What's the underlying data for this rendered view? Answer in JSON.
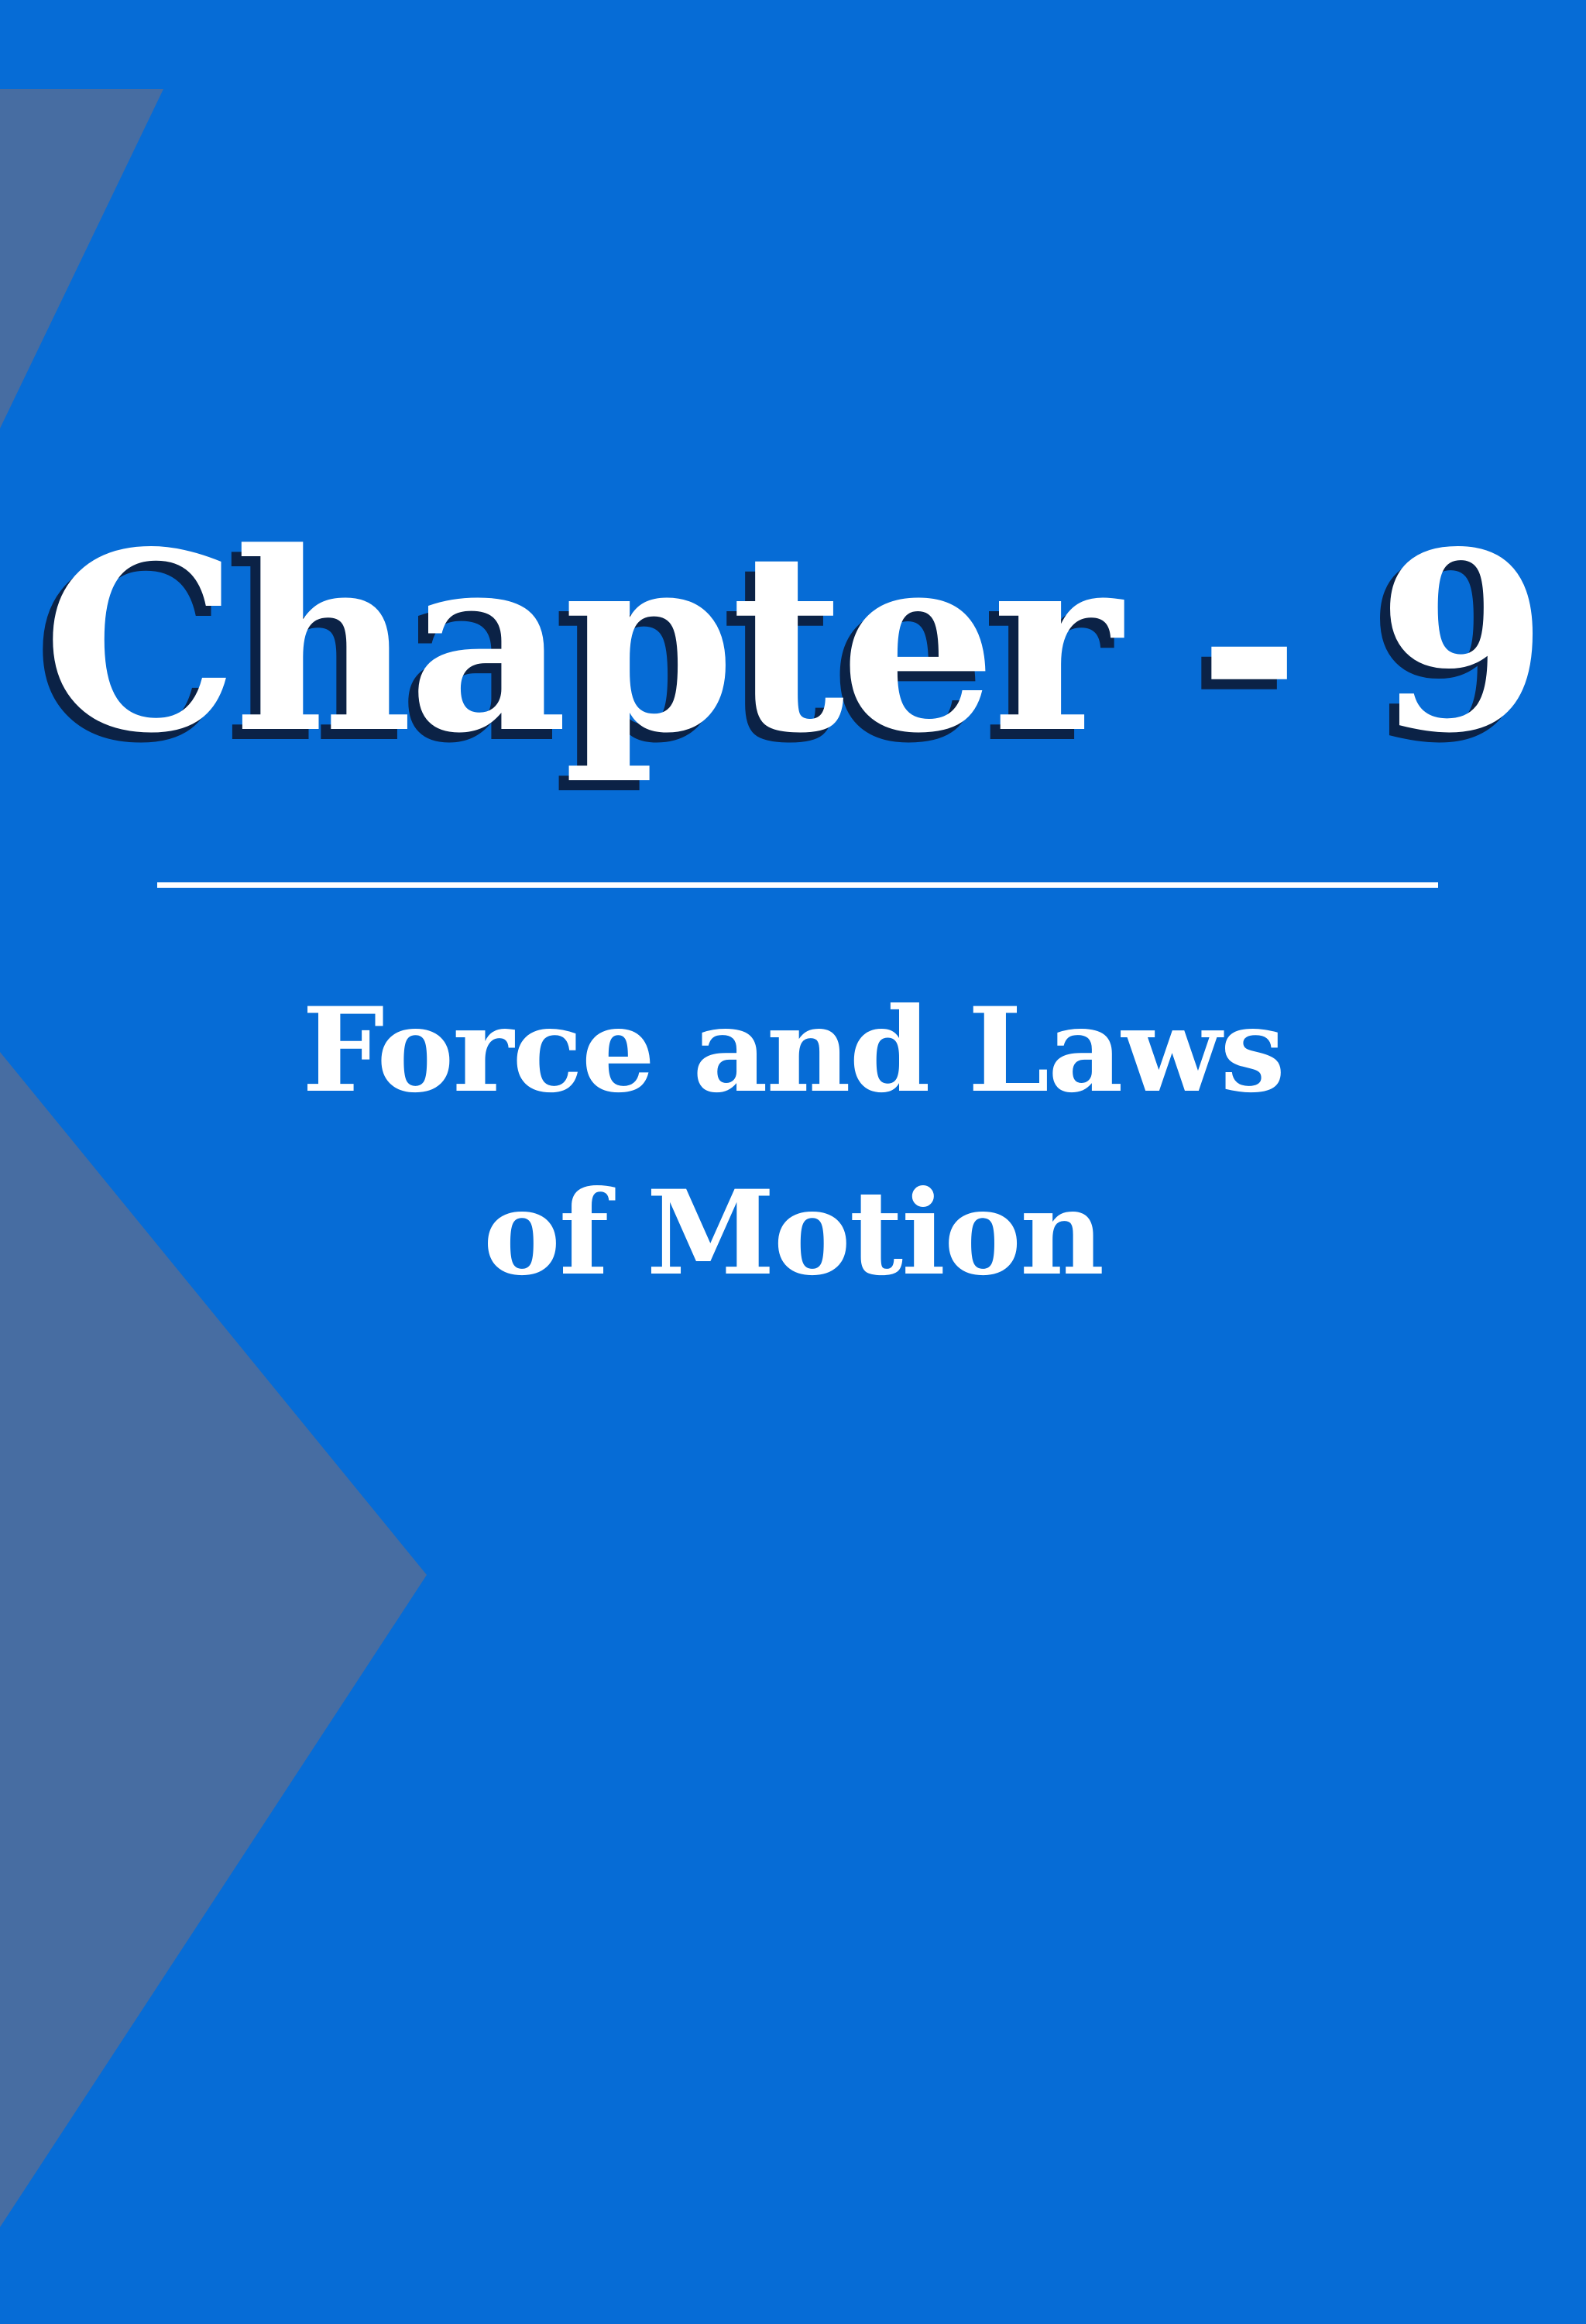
{
  "cover": {
    "chapter_title": "Chapter - 9",
    "subtitle_line1": "Force and Laws",
    "subtitle_line2": "of Motion"
  },
  "colors": {
    "background": "#066cd6",
    "accent_shape": "#476da2",
    "text": "#ffffff",
    "title_shadow": "#0b2246"
  }
}
